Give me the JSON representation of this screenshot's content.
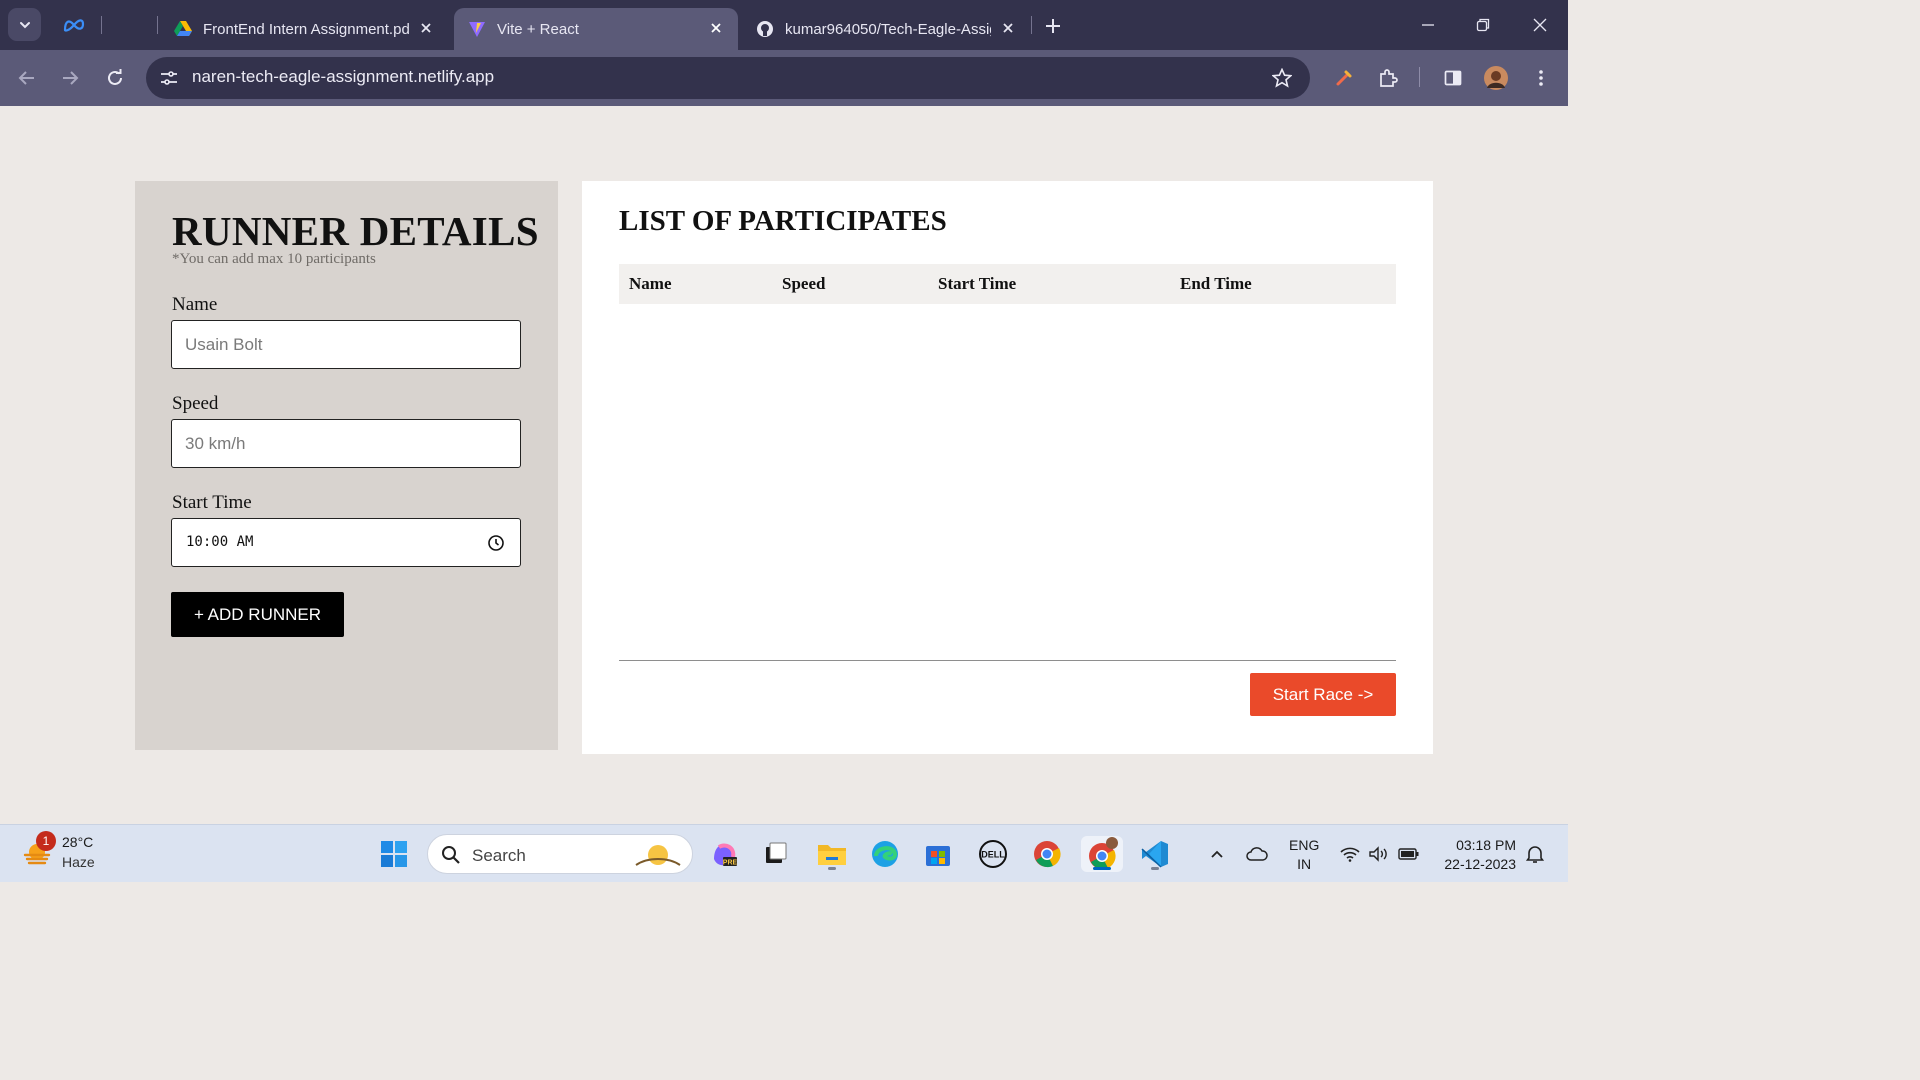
{
  "browser": {
    "tabs": [
      {
        "title": "FrontEnd Intern Assignment.pd",
        "icon": "google-drive-icon",
        "active": false
      },
      {
        "title": "Vite + React",
        "icon": "vite-icon",
        "active": true
      },
      {
        "title": "kumar964050/Tech-Eagle-Assig",
        "icon": "github-icon",
        "active": false
      }
    ],
    "url": "naren-tech-eagle-assignment.netlify.app"
  },
  "runner_form": {
    "title": "RUNNER DETAILS",
    "subtitle": "*You can add max 10 participants",
    "name_label": "Name",
    "name_placeholder": "Usain Bolt",
    "speed_label": "Speed",
    "speed_placeholder": "30 km/h",
    "start_time_label": "Start Time",
    "start_time_value": "10:00 AM",
    "add_button": "+ ADD RUNNER"
  },
  "participants": {
    "title": "LIST OF PARTICIPATES",
    "columns": [
      "Name",
      "Speed",
      "Start Time",
      "End Time"
    ],
    "rows": [],
    "start_button": "Start Race ->"
  },
  "taskbar": {
    "weather_temp": "28°C",
    "weather_cond": "Haze",
    "notification_count": "1",
    "search_label": "Search",
    "lang_line1": "ENG",
    "lang_line2": "IN",
    "time": "03:18 PM",
    "date": "22-12-2023"
  },
  "colors": {
    "accent_start": "#ea4a2a",
    "add_button": "#000000",
    "form_panel": "#d8d3cf",
    "page_bg": "#ede9e6",
    "chrome_frame": "#33324c",
    "chrome_toolbar": "#5b5a78"
  }
}
